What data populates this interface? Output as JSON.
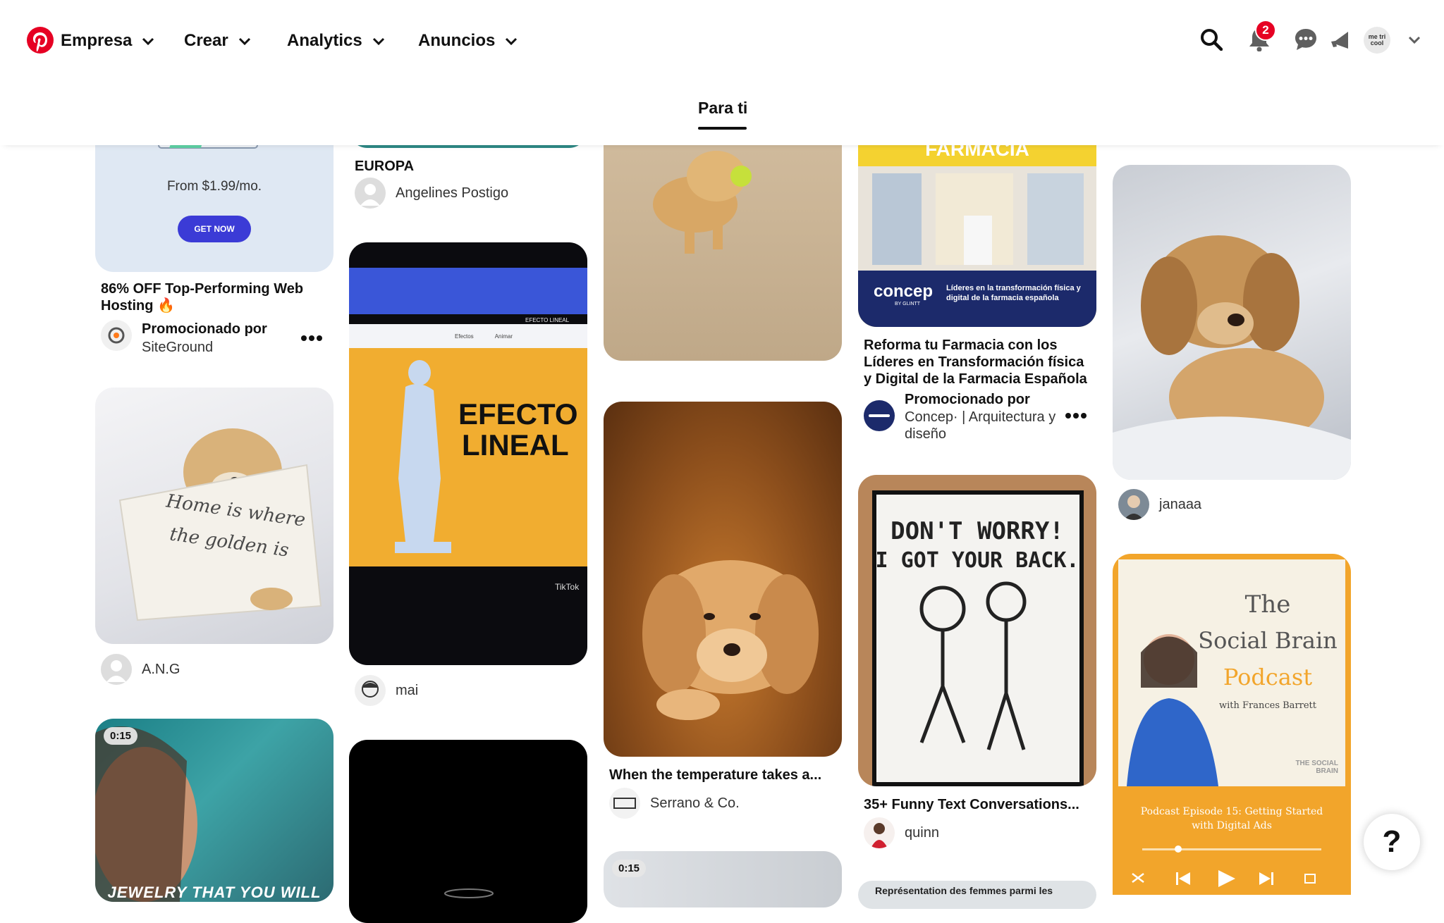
{
  "nav": {
    "items": [
      {
        "label": "Empresa"
      },
      {
        "label": "Crear"
      },
      {
        "label": "Analytics"
      },
      {
        "label": "Anuncios"
      }
    ],
    "notifications_count": "2",
    "avatar_text": "me tri cool"
  },
  "tabs": {
    "for_you": "Para ti"
  },
  "pins": {
    "siteground": {
      "price_text": "From $1.99/mo.",
      "cta": "GET NOW",
      "title": "86% OFF Top-Performing Web Hosting 🔥",
      "promoted_label": "Promocionado por",
      "advertiser": "SiteGround"
    },
    "pillow_dog": {
      "pillow_text_1": "Home is where",
      "pillow_text_2": "the golden is",
      "user": "A.N.G"
    },
    "jewelry_video": {
      "duration": "0:15",
      "overlay_text": "JEWELRY THAT YOU WILL"
    },
    "europa": {
      "title": "EUROPA",
      "user": "Angelines Postigo"
    },
    "efecto_lineal": {
      "headline_1": "EFECTO",
      "headline_2": "LINEAL",
      "toolbar_label": "EFECTO LINEAL",
      "toolbar_items": [
        "Efectos",
        "Animar"
      ],
      "watermark": "TikTok",
      "user": "mai"
    },
    "puppy_closeup": {
      "title": "When the temperature takes a...",
      "user": "Serrano & Co."
    },
    "bottom_video": {
      "duration": "0:15"
    },
    "farmacia": {
      "store_sign": "FARMACIA",
      "brand": "concep",
      "brand_sub": "BY GLINTT",
      "banner_text": "Líderes en la transformación física y digital de la farmacia española",
      "title": "Reforma tu Farmacia con los Líderes en Transformación física y Digital de la Farmacia Española",
      "promoted_label": "Promocionado por",
      "advertiser": "Concep· | Arquitectura y diseño"
    },
    "dont_worry": {
      "sign_line_1": "DON'T WORRY!",
      "sign_line_2": "I GOT YOUR BACK.",
      "title": "35+ Funny Text Conversations...",
      "user": "quinn"
    },
    "representation": {
      "snippet": "Représentation des femmes parmi les"
    },
    "puppy_bed": {
      "user": "janaaa"
    },
    "podcast": {
      "title_1": "The",
      "title_2": "Social Brain",
      "title_3": "Podcast",
      "host": "with Frances Barrett",
      "brand": "THE SOCIAL BRAIN",
      "episode": "Podcast Episode 15: Getting Started with Digital Ads"
    }
  },
  "help": {
    "label": "?"
  },
  "colors": {
    "brand_red": "#e60023",
    "cta_blue": "#3b3bd6",
    "podcast_orange": "#f2a52b"
  }
}
